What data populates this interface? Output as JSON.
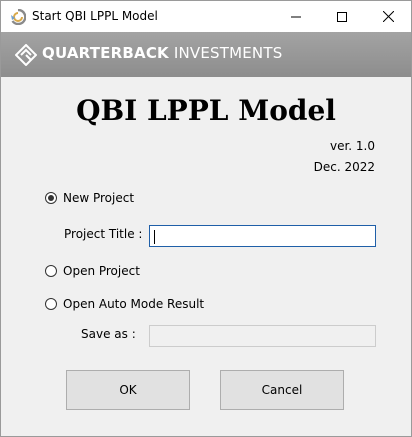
{
  "window": {
    "title": "Start QBI LPPL Model"
  },
  "banner": {
    "brand_bold": "QUARTERBACK",
    "brand_light": "INVESTMENTS"
  },
  "header": {
    "title": "QBI LPPL Model",
    "version": "ver. 1.0",
    "date": "Dec. 2022"
  },
  "options": {
    "new_project": {
      "label": "New Project",
      "checked": true
    },
    "open_project": {
      "label": "Open Project",
      "checked": false
    },
    "open_auto": {
      "label": "Open Auto Mode Result",
      "checked": false
    }
  },
  "fields": {
    "project_title_label": "Project Title :",
    "project_title_value": "",
    "save_as_label": "Save as :",
    "save_as_value": ""
  },
  "buttons": {
    "ok": "OK",
    "cancel": "Cancel"
  },
  "icons": {
    "app": "app-icon",
    "logo": "quarterback-logo-icon"
  }
}
